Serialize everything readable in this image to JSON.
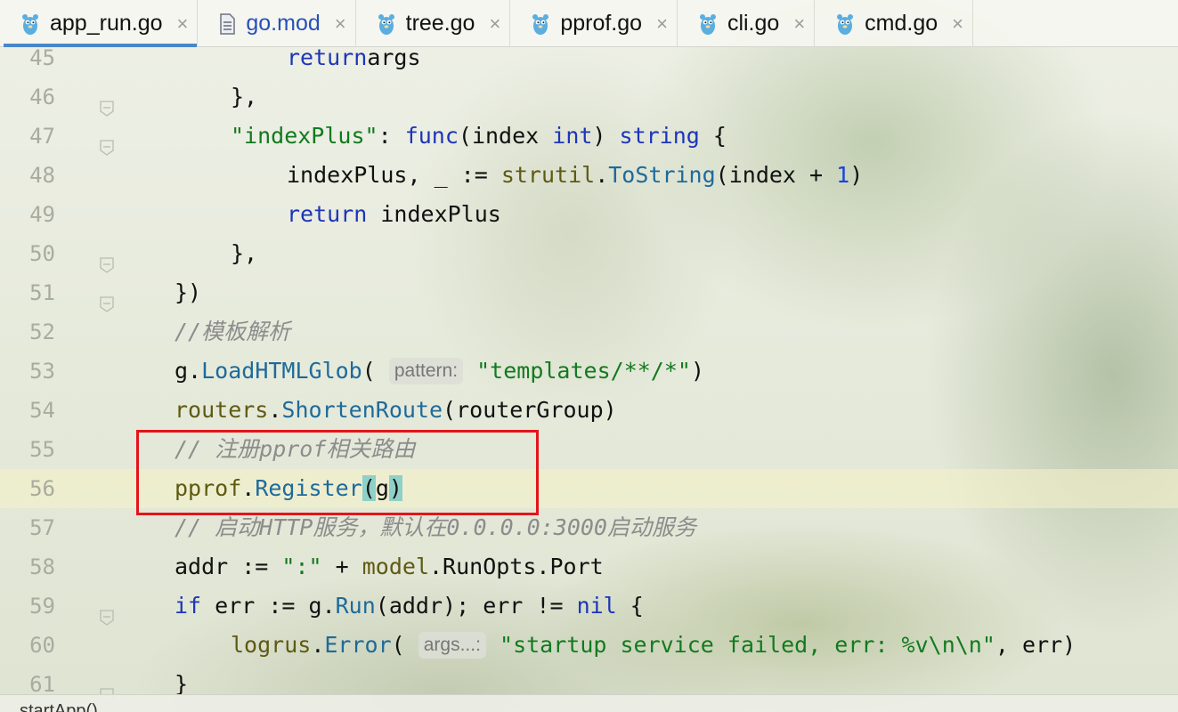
{
  "tabs": [
    {
      "label": "app_run.go",
      "icon": "gopher-icon",
      "active": true,
      "blue": false
    },
    {
      "label": "go.mod",
      "icon": "file-icon",
      "active": false,
      "blue": true
    },
    {
      "label": "tree.go",
      "icon": "gopher-icon",
      "active": false,
      "blue": false
    },
    {
      "label": "pprof.go",
      "icon": "gopher-icon",
      "active": false,
      "blue": false
    },
    {
      "label": "cli.go",
      "icon": "gopher-icon",
      "active": false,
      "blue": false
    },
    {
      "label": "cmd.go",
      "icon": "gopher-icon",
      "active": false,
      "blue": false
    }
  ],
  "close_glyph": "×",
  "lines": [
    {
      "n": "45",
      "fold": false,
      "indent": 3,
      "tokens": [
        [
          "kw",
          "return"
        ],
        [
          "",
          "args"
        ]
      ]
    },
    {
      "n": "46",
      "fold": true,
      "indent": 2,
      "tokens": [
        [
          "",
          "},"
        ]
      ]
    },
    {
      "n": "47",
      "fold": true,
      "indent": 2,
      "tokens": [
        [
          "str",
          "\"indexPlus\""
        ],
        [
          "",
          ": "
        ],
        [
          "kw",
          "func"
        ],
        [
          "",
          "(index "
        ],
        [
          "kw",
          "int"
        ],
        [
          "",
          ") "
        ],
        [
          "kw",
          "string"
        ],
        [
          "",
          " {"
        ]
      ]
    },
    {
      "n": "48",
      "fold": false,
      "indent": 3,
      "tokens": [
        [
          "",
          "indexPlus, _ := "
        ],
        [
          "pkg",
          "strutil"
        ],
        [
          "",
          "."
        ],
        [
          "fn",
          "ToString"
        ],
        [
          "",
          "(index + "
        ],
        [
          "num",
          "1"
        ],
        [
          "",
          ")"
        ]
      ]
    },
    {
      "n": "49",
      "fold": false,
      "indent": 3,
      "tokens": [
        [
          "kw",
          "return"
        ],
        [
          "",
          " indexPlus"
        ]
      ]
    },
    {
      "n": "50",
      "fold": true,
      "indent": 2,
      "tokens": [
        [
          "",
          "},"
        ]
      ]
    },
    {
      "n": "51",
      "fold": true,
      "indent": 1,
      "tokens": [
        [
          "",
          "})"
        ]
      ]
    },
    {
      "n": "52",
      "fold": false,
      "indent": 1,
      "tokens": [
        [
          "cmt",
          "//模板解析"
        ]
      ]
    },
    {
      "n": "53",
      "fold": false,
      "indent": 1,
      "tokens": [
        [
          "",
          "g."
        ],
        [
          "fn",
          "LoadHTMLGlob"
        ],
        [
          "",
          "( "
        ],
        [
          "hint",
          "pattern:"
        ],
        [
          "",
          " "
        ],
        [
          "str",
          "\"templates/**/*\""
        ],
        [
          "",
          ")"
        ]
      ]
    },
    {
      "n": "54",
      "fold": false,
      "indent": 1,
      "tokens": [
        [
          "pkg",
          "routers"
        ],
        [
          "",
          "."
        ],
        [
          "fn",
          "ShortenRoute"
        ],
        [
          "",
          "(routerGroup)"
        ]
      ]
    },
    {
      "n": "55",
      "fold": false,
      "indent": 1,
      "tokens": [
        [
          "cmt",
          "// 注册pprof相关路由"
        ]
      ]
    },
    {
      "n": "56",
      "fold": false,
      "indent": 1,
      "current": true,
      "tokens": [
        [
          "pkg",
          "pprof"
        ],
        [
          "",
          "."
        ],
        [
          "fn",
          "Register"
        ],
        [
          "brace",
          "("
        ],
        [
          "",
          "g"
        ],
        [
          "brace",
          ")"
        ]
      ]
    },
    {
      "n": "57",
      "fold": false,
      "indent": 1,
      "tokens": [
        [
          "cmt",
          "// 启动HTTP服务，默认在0.0.0.0:3000启动服务"
        ]
      ]
    },
    {
      "n": "58",
      "fold": false,
      "indent": 1,
      "tokens": [
        [
          "",
          "addr := "
        ],
        [
          "str",
          "\":\""
        ],
        [
          "",
          " + "
        ],
        [
          "pkg",
          "model"
        ],
        [
          "",
          ".RunOpts.Port"
        ]
      ]
    },
    {
      "n": "59",
      "fold": true,
      "indent": 1,
      "tokens": [
        [
          "kw",
          "if"
        ],
        [
          "",
          " err := g."
        ],
        [
          "fn",
          "Run"
        ],
        [
          "",
          "(addr); err != "
        ],
        [
          "kw",
          "nil"
        ],
        [
          "",
          " {"
        ]
      ]
    },
    {
      "n": "60",
      "fold": false,
      "indent": 2,
      "tokens": [
        [
          "pkg",
          "logrus"
        ],
        [
          "",
          "."
        ],
        [
          "fn",
          "Error"
        ],
        [
          "",
          "( "
        ],
        [
          "hint",
          "args...:"
        ],
        [
          "",
          " "
        ],
        [
          "str",
          "\"startup service failed, err: %v\\n\\n\""
        ],
        [
          "",
          ", err)"
        ]
      ]
    },
    {
      "n": "61",
      "fold": true,
      "indent": 1,
      "tokens": [
        [
          "",
          "}"
        ]
      ]
    }
  ],
  "status": {
    "breadcrumb": "startApp()"
  },
  "colors": {
    "active_tab_underline": "#4a86c8",
    "highlight_box": "#e4141b",
    "keyword": "#1d35b8",
    "string": "#127a1f"
  }
}
